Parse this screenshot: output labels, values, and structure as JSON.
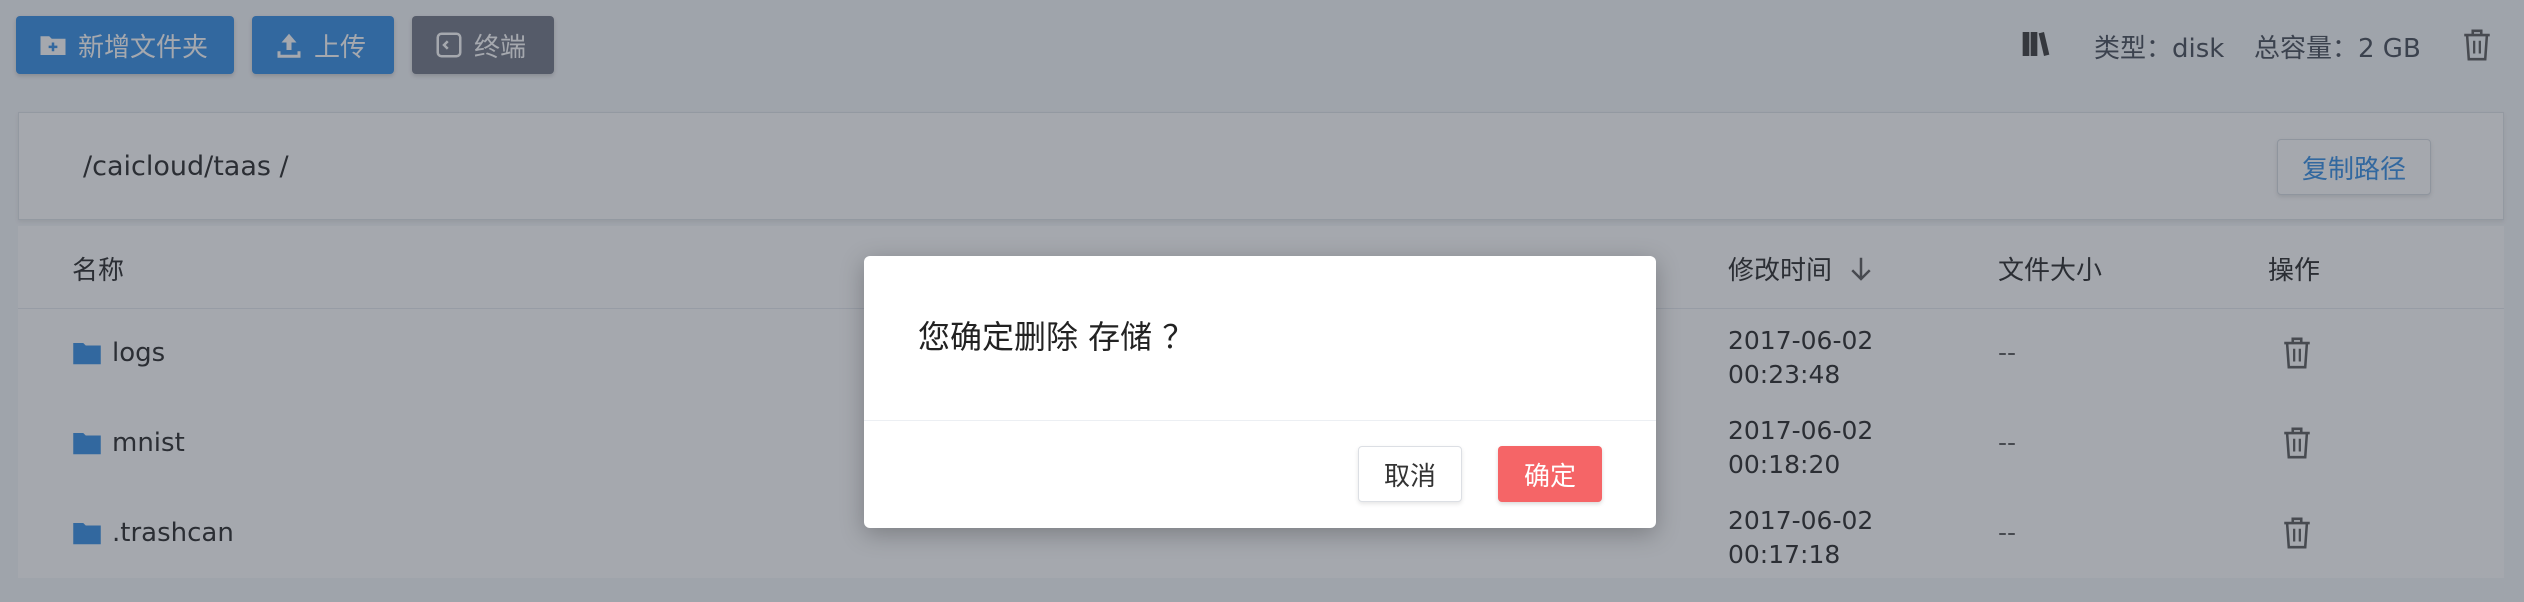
{
  "toolbar": {
    "new_folder_label": "新增文件夹",
    "upload_label": "上传",
    "terminal_label": "终端",
    "type_text": "类型：disk",
    "capacity_text": "总容量：2 GB"
  },
  "path": {
    "text": "/caicloud/taas  /",
    "copy_label": "复制路径"
  },
  "table": {
    "headers": {
      "name": "名称",
      "modified": "修改时间",
      "size": "文件大小",
      "actions": "操作"
    },
    "rows": [
      {
        "name": "logs",
        "modified": "2017-06-02\n00:23:48",
        "size": "--"
      },
      {
        "name": "mnist",
        "modified": "2017-06-02\n00:18:20",
        "size": "--"
      },
      {
        "name": ".trashcan",
        "modified": "2017-06-02\n00:17:18",
        "size": "--"
      }
    ]
  },
  "dialog": {
    "message": "您确定删除 存储 ？",
    "cancel_label": "取消",
    "confirm_label": "确定"
  },
  "colors": {
    "primary": "#2f8be3",
    "terminal": "#6d7482",
    "danger": "#f56567",
    "folder": "#2f8be3"
  },
  "icons": {
    "new_folder": "folder-plus-icon",
    "upload": "upload-icon",
    "terminal": "terminal-icon",
    "storage": "books-icon",
    "delete": "trash-icon",
    "sort": "arrow-down-icon",
    "folder": "folder-icon"
  }
}
